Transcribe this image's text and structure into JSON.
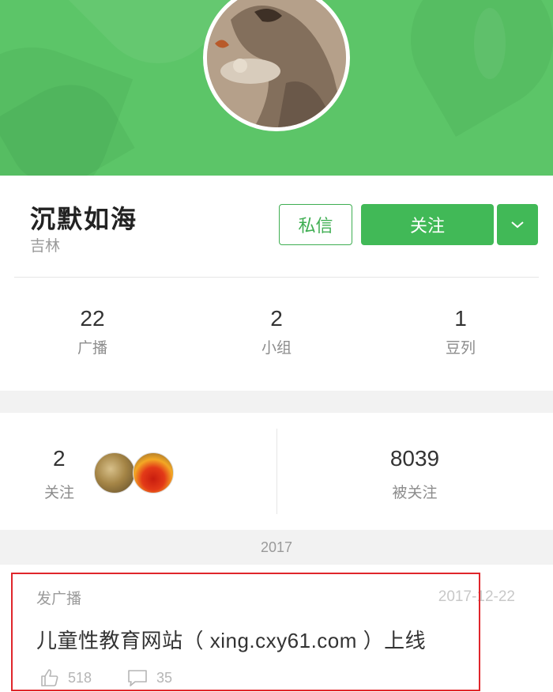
{
  "profile": {
    "name": "沉默如海",
    "location": "吉林",
    "message_button": "私信",
    "follow_button": "关注"
  },
  "stats": [
    {
      "value": "22",
      "label": "广播"
    },
    {
      "value": "2",
      "label": "小组"
    },
    {
      "value": "1",
      "label": "豆列"
    }
  ],
  "following": {
    "value": "2",
    "label": "关注"
  },
  "followers": {
    "value": "8039",
    "label": "被关注"
  },
  "timeline": {
    "year": "2017",
    "post": {
      "type": "发广播",
      "date": "2017-12-22",
      "title": "儿童性教育网站（ xing.cxy61.com ）上线",
      "likes": "518",
      "comments": "35"
    }
  },
  "colors": {
    "banner": "#5cc568",
    "accent": "#41b957",
    "highlight": "#e0262b"
  }
}
